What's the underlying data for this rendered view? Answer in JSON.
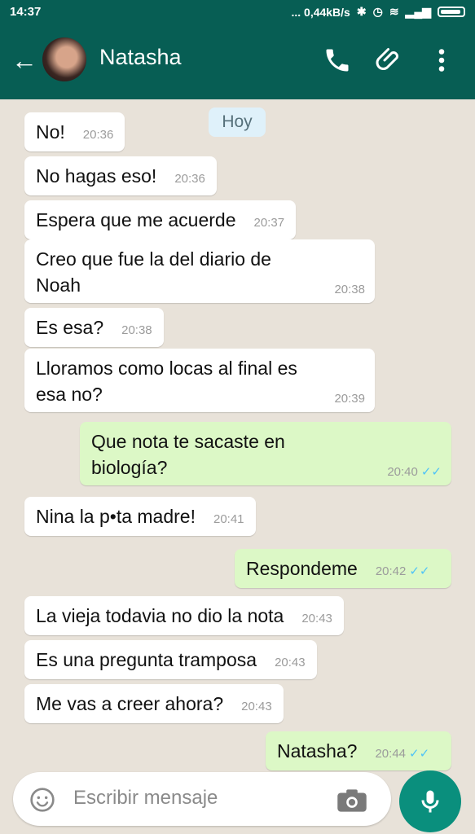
{
  "status_bar": {
    "time": "14:37",
    "network": "... 0,44kB/s"
  },
  "header": {
    "contact_name": "Natasha",
    "icons": [
      "back-arrow-icon",
      "avatar",
      "phone-icon",
      "paperclip-icon",
      "more-vert-icon"
    ]
  },
  "chat": {
    "date_chip": "Hoy",
    "messages": [
      {
        "dir": "in",
        "text": "No!",
        "time": "20:36"
      },
      {
        "dir": "in",
        "text": "No hagas eso!",
        "time": "20:36"
      },
      {
        "dir": "in",
        "text": "Espera que me acuerde",
        "time": "20:37"
      },
      {
        "dir": "in",
        "text": "Creo que fue la del diario de Noah",
        "time": "20:38"
      },
      {
        "dir": "in",
        "text": "Es esa?",
        "time": "20:38"
      },
      {
        "dir": "in",
        "text": "Lloramos como locas al final es esa no?",
        "time": "20:39"
      },
      {
        "dir": "out",
        "text": "Que nota te sacaste en biología?",
        "time": "20:40",
        "ticks": "✓✓"
      },
      {
        "dir": "in",
        "text": "Nina la p•ta madre!",
        "time": "20:41"
      },
      {
        "dir": "out",
        "text": "Respondeme",
        "time": "20:42",
        "ticks": "✓✓"
      },
      {
        "dir": "in",
        "text": "La vieja todavia no dio la nota",
        "time": "20:43"
      },
      {
        "dir": "in",
        "text": "Es una pregunta tramposa",
        "time": "20:43"
      },
      {
        "dir": "in",
        "text": "Me vas a creer ahora?",
        "time": "20:43"
      },
      {
        "dir": "out",
        "text": "Natasha?",
        "time": "20:44",
        "ticks": "✓✓"
      }
    ]
  },
  "composer": {
    "placeholder": "Escribir mensaje"
  },
  "colors": {
    "header": "#075e54",
    "outgoing_bubble": "#dcf8c6",
    "incoming_bubble": "#ffffff",
    "read_ticks": "#4fc3f7",
    "mic_button": "#0a8f7d"
  }
}
